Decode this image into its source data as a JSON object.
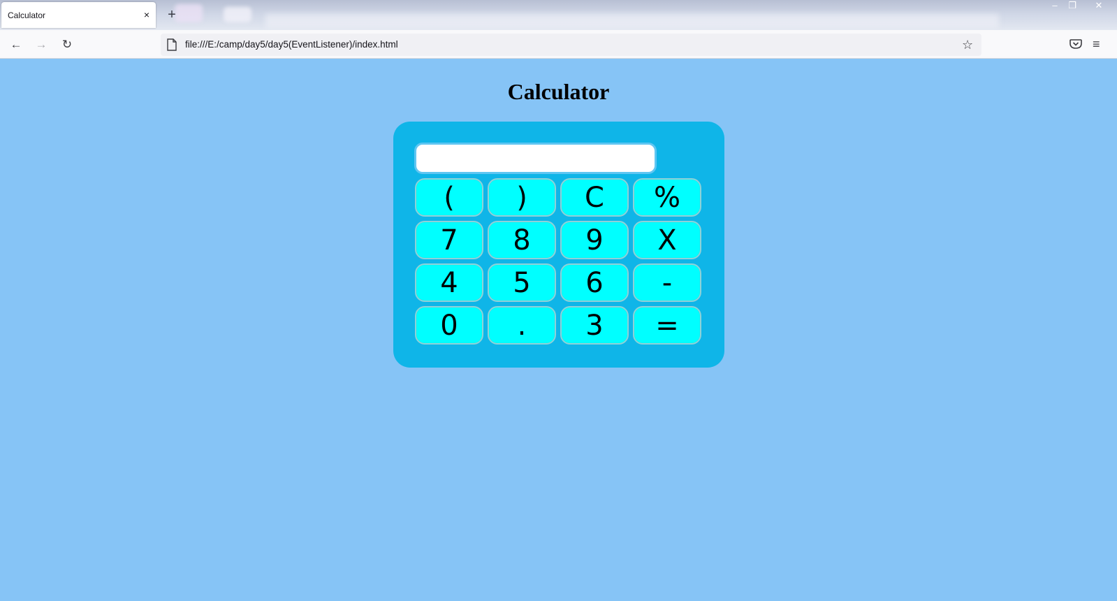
{
  "browser": {
    "tab_title": "Calculator",
    "tab_close": "×",
    "new_tab": "+",
    "window_min": "–",
    "window_max": "❐",
    "window_close": "✕",
    "nav_back": "←",
    "nav_forward": "→",
    "nav_reload": "↻",
    "url": "file:///E:/camp/day5/day5(EventListener)/index.html",
    "bookmark_star": "☆",
    "menu": "≡"
  },
  "page": {
    "title": "Calculator",
    "display_value": "",
    "keys": [
      "(",
      ")",
      "C",
      "%",
      "7",
      "8",
      "9",
      "X",
      "4",
      "5",
      "6",
      "-",
      "0",
      ".",
      "3",
      "="
    ]
  },
  "colors": {
    "page_background": "#86c4f6",
    "calculator_body": "#0fb5e8",
    "key_background": "#00ffff",
    "display_background": "#ffffff"
  }
}
